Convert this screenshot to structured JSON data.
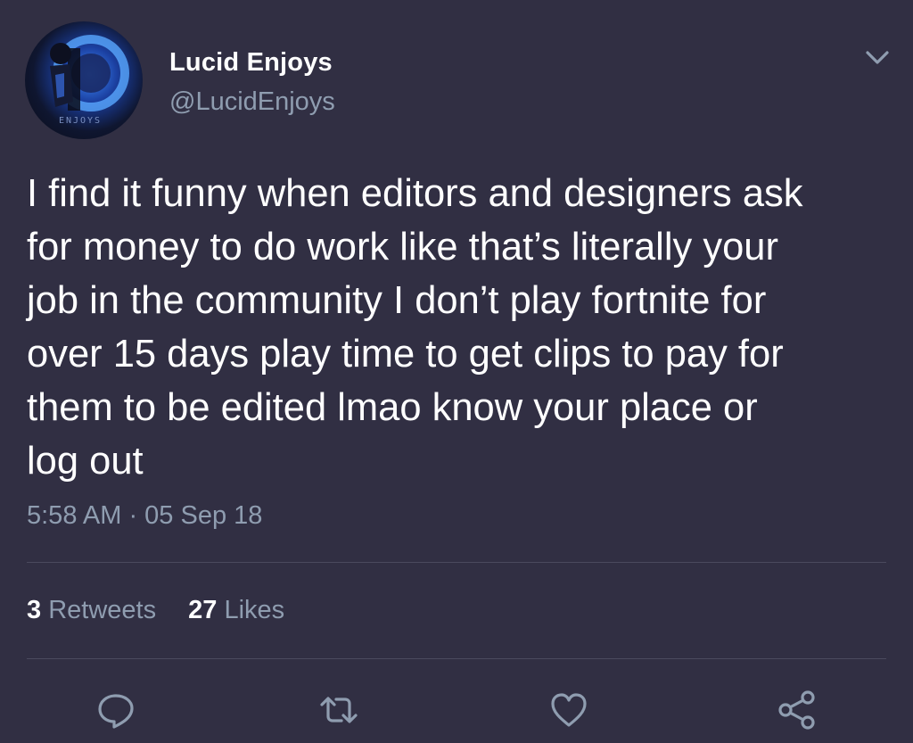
{
  "user": {
    "display_name": "Lucid Enjoys",
    "handle": "@LucidEnjoys",
    "avatar_icon": "profile-avatar"
  },
  "tweet": {
    "text": "I find it funny when editors and designers ask\nfor money to do work like that’s literally your\njob in the community I don’t play fortnite for\nover 15 days play time to get clips to pay for\nthem to be edited lmao know your place or\nlog out",
    "timestamp": "5:58 AM · 05 Sep 18"
  },
  "stats": {
    "retweets_count": "3",
    "retweets_label": "Retweets",
    "likes_count": "27",
    "likes_label": "Likes"
  },
  "actions": {
    "icons": [
      "reply-icon",
      "retweet-icon",
      "like-icon",
      "share-icon"
    ]
  },
  "colors": {
    "background": "#312f43",
    "text_primary": "#ffffff",
    "text_secondary": "#8f9db0",
    "divider": "#4b4a5e"
  }
}
